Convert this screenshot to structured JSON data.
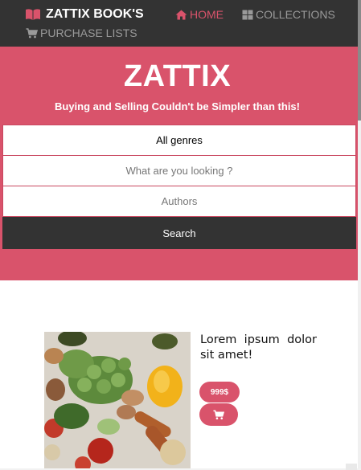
{
  "navbar": {
    "brand": "ZATTIX BOOK'S",
    "brand_icon": "book-open-icon",
    "links": [
      {
        "label": "HOME",
        "icon": "home-icon",
        "active": true
      },
      {
        "label": "COLLECTIONS",
        "icon": "grid-icon",
        "active": false
      },
      {
        "label": "PURCHASE LISTS",
        "icon": "cart-icon",
        "active": false
      }
    ]
  },
  "hero": {
    "title": "ZATTIX",
    "subtitle": "Buying and Selling Couldn't be Simpler than this!",
    "genre_select": "All genres",
    "search_placeholder": "What are you looking ?",
    "authors_placeholder": "Authors",
    "submit_label": "Search"
  },
  "product": {
    "text_line1": "Lorem ipsum dolor",
    "text_line2": "sit amet!",
    "price": "999$",
    "cart_icon": "cart-icon"
  },
  "colors": {
    "accent": "#d9536b",
    "dark": "#333333",
    "muted": "#9a9a9a"
  }
}
